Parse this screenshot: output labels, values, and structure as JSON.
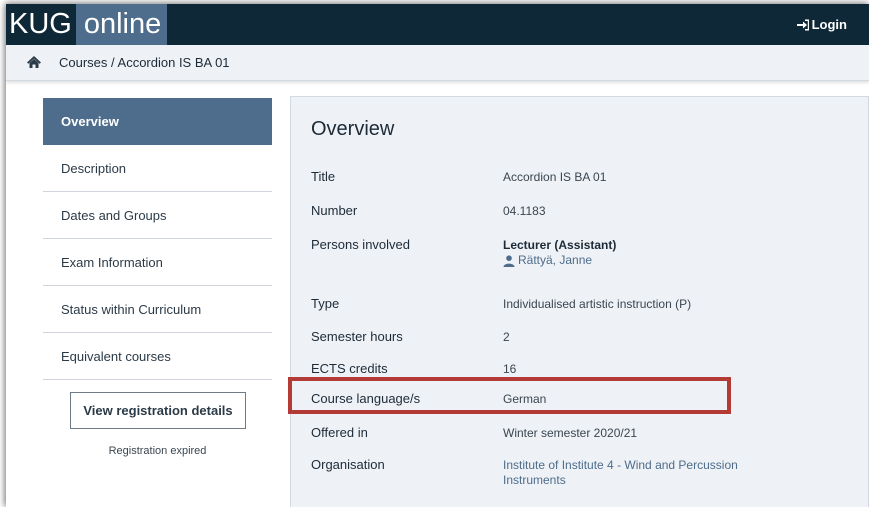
{
  "header": {
    "logo_part1": "KUG",
    "logo_part2": "online",
    "login_label": "Login"
  },
  "breadcrumb": {
    "text": "Courses / Accordion IS BA 01"
  },
  "sidebar": {
    "items": [
      {
        "label": "Overview",
        "active": true
      },
      {
        "label": "Description"
      },
      {
        "label": "Dates and Groups"
      },
      {
        "label": "Exam Information"
      },
      {
        "label": "Status within Curriculum"
      },
      {
        "label": "Equivalent courses"
      }
    ],
    "registration_button": "View registration details",
    "registration_status": "Registration expired"
  },
  "main": {
    "title": "Overview",
    "rows": [
      {
        "label": "Title",
        "value": "Accordion IS BA 01"
      },
      {
        "label": "Number",
        "value": "04.1183"
      },
      {
        "label": "Persons involved",
        "value": "Lecturer (Assistant)",
        "person": "Rättyä, Janne"
      },
      {
        "label": "Type",
        "value": "Individualised artistic instruction (P)"
      },
      {
        "label": "Semester hours",
        "value": "2"
      },
      {
        "label": "ECTS credits",
        "value": "16"
      },
      {
        "label": "Course language/s",
        "value": "German"
      },
      {
        "label": "Offered in",
        "value": "Winter semester 2020/21"
      },
      {
        "label": "Organisation",
        "value_line1": "Institute of Institute 4 - Wind and Percussion",
        "value_line2": "Instruments"
      }
    ]
  },
  "colors": {
    "header_bg": "#0f2838",
    "accent": "#4e6d8c",
    "highlight": "#b43a36"
  }
}
